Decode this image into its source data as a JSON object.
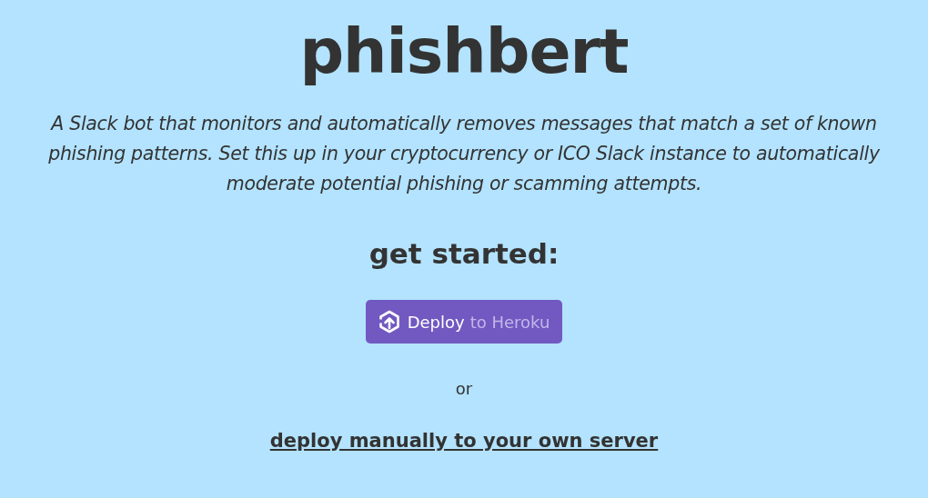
{
  "title": "phishbert",
  "description": "A Slack bot that monitors and automatically removes messages that match a set of known phishing patterns. Set this up in your cryptocurrency or ICO Slack instance to automatically moderate potential phishing or scamming attempts.",
  "heading": "get started:",
  "deploy_button": {
    "label": "Deploy",
    "label_suffix": "to Heroku"
  },
  "separator": "or",
  "manual_link": "deploy manually to your own server"
}
